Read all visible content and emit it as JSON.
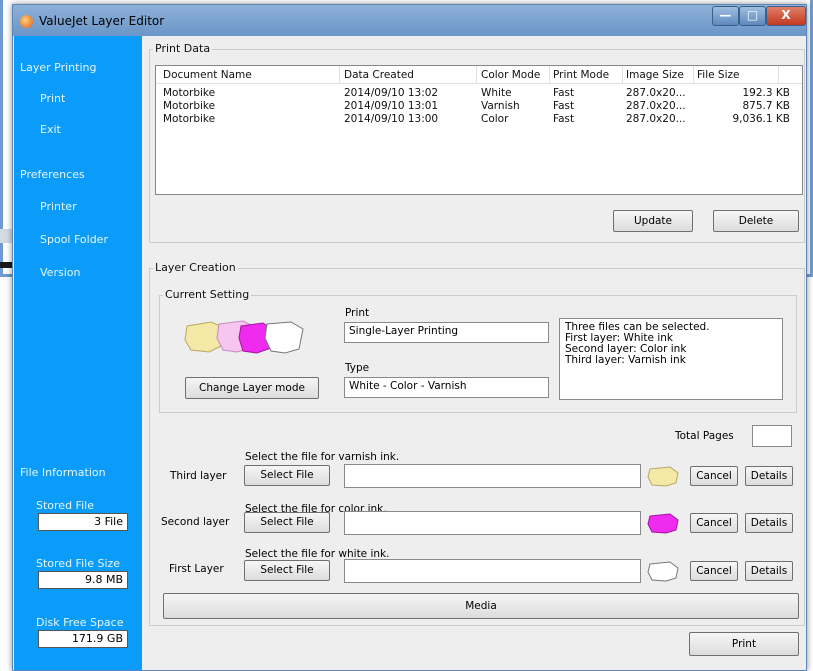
{
  "window": {
    "title": "ValueJet Layer Editor",
    "min": "—",
    "max": "□",
    "close": "X"
  },
  "sidebar": {
    "section1": "Layer Printing",
    "print": "Print",
    "exit": "Exit",
    "section2": "Preferences",
    "printer": "Printer",
    "spool": "Spool Folder",
    "version": "Version",
    "file_info": "File Information",
    "stored_file_label": "Stored File",
    "stored_file_value": "3 File",
    "stored_size_label": "Stored File Size",
    "stored_size_value": "9.8 MB",
    "disk_label": "Disk Free Space",
    "disk_value": "171.9 GB"
  },
  "print_data": {
    "group": "Print Data",
    "columns": [
      "Document Name",
      "Data Created",
      "Color Mode",
      "Print Mode",
      "Image Size",
      "File Size"
    ],
    "rows": [
      [
        "Motorbike",
        "2014/09/10 13:02",
        "White",
        "Fast",
        "287.0x20...",
        "192.3 KB"
      ],
      [
        "Motorbike",
        "2014/09/10 13:01",
        "Varnish",
        "Fast",
        "287.0x20...",
        "875.7 KB"
      ],
      [
        "Motorbike",
        "2014/09/10 13:00",
        "Color",
        "Fast",
        "287.0x20...",
        "9,036.1 KB"
      ]
    ],
    "update": "Update",
    "delete": "Delete"
  },
  "layer_creation": {
    "group": "Layer Creation",
    "current": "Current Setting",
    "print_label": "Print",
    "print_value": "Single-Layer Printing",
    "type_label": "Type",
    "type_value": "White - Color - Varnish",
    "change_mode": "Change Layer mode",
    "note_lines": [
      "Three files can be selected.",
      "First layer: White ink",
      "Second layer: Color ink",
      "Third layer: Varnish ink"
    ],
    "total_pages": "Total Pages",
    "layers": [
      {
        "name": "Third layer",
        "hint": "Select the file for varnish ink.",
        "select": "Select File",
        "cancel": "Cancel",
        "details": "Details",
        "thumb_color": "#f3e8a6"
      },
      {
        "name": "Second layer",
        "hint": "Select the file for color ink.",
        "select": "Select File",
        "cancel": "Cancel",
        "details": "Details",
        "thumb_color": "#f02bf0"
      },
      {
        "name": "First Layer",
        "hint": "Select the file for white ink.",
        "select": "Select File",
        "cancel": "Cancel",
        "details": "Details",
        "thumb_color": "#ffffff"
      }
    ],
    "media": "Media",
    "print_btn": "Print"
  },
  "colors": {
    "sidebar": "#0a9cf8",
    "titlebar": "#7aa3d1",
    "close": "#c9442a"
  }
}
